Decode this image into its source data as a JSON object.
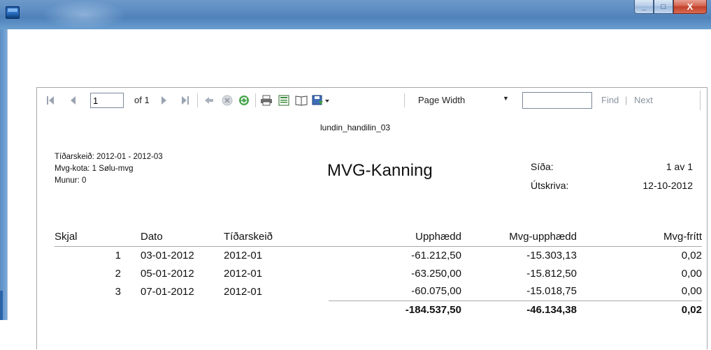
{
  "toolbar": {
    "page_value": "1",
    "of_text": "of 1",
    "zoom_value": "Page Width",
    "find_label": "Find",
    "find_separator": "|",
    "next_label": "Next"
  },
  "report": {
    "name": "lundin_handilin_03",
    "meta_lines": [
      "Tíðarskeið: 2012-01 - 2012-03",
      "Mvg-kota: 1 Sølu-mvg",
      "Munur: 0"
    ],
    "title": "MVG-Kanning",
    "page_label": "Síða:",
    "page_value": "1 av 1",
    "print_label": "Útskriva:",
    "print_value": "12-10-2012",
    "columns": [
      "Skjal",
      "Dato",
      "Tíðarskeið",
      "Upphædd",
      "Mvg-upphædd",
      "Mvg-frítt"
    ],
    "rows": [
      [
        "1",
        "03-01-2012",
        "2012-01",
        "-61.212,50",
        "-15.303,13",
        "0,02"
      ],
      [
        "2",
        "05-01-2012",
        "2012-01",
        "-63.250,00",
        "-15.812,50",
        "0,00"
      ],
      [
        "3",
        "07-01-2012",
        "2012-01",
        "-60.075,00",
        "-15.018,75",
        "0,00"
      ]
    ],
    "totals": {
      "upphaedd": "-184.537,50",
      "mvg_upphaedd": "-46.134,38",
      "mvg_fritt": "0,02"
    }
  },
  "window_buttons": {
    "minimize": "_",
    "maximize": "□",
    "close": "X"
  }
}
